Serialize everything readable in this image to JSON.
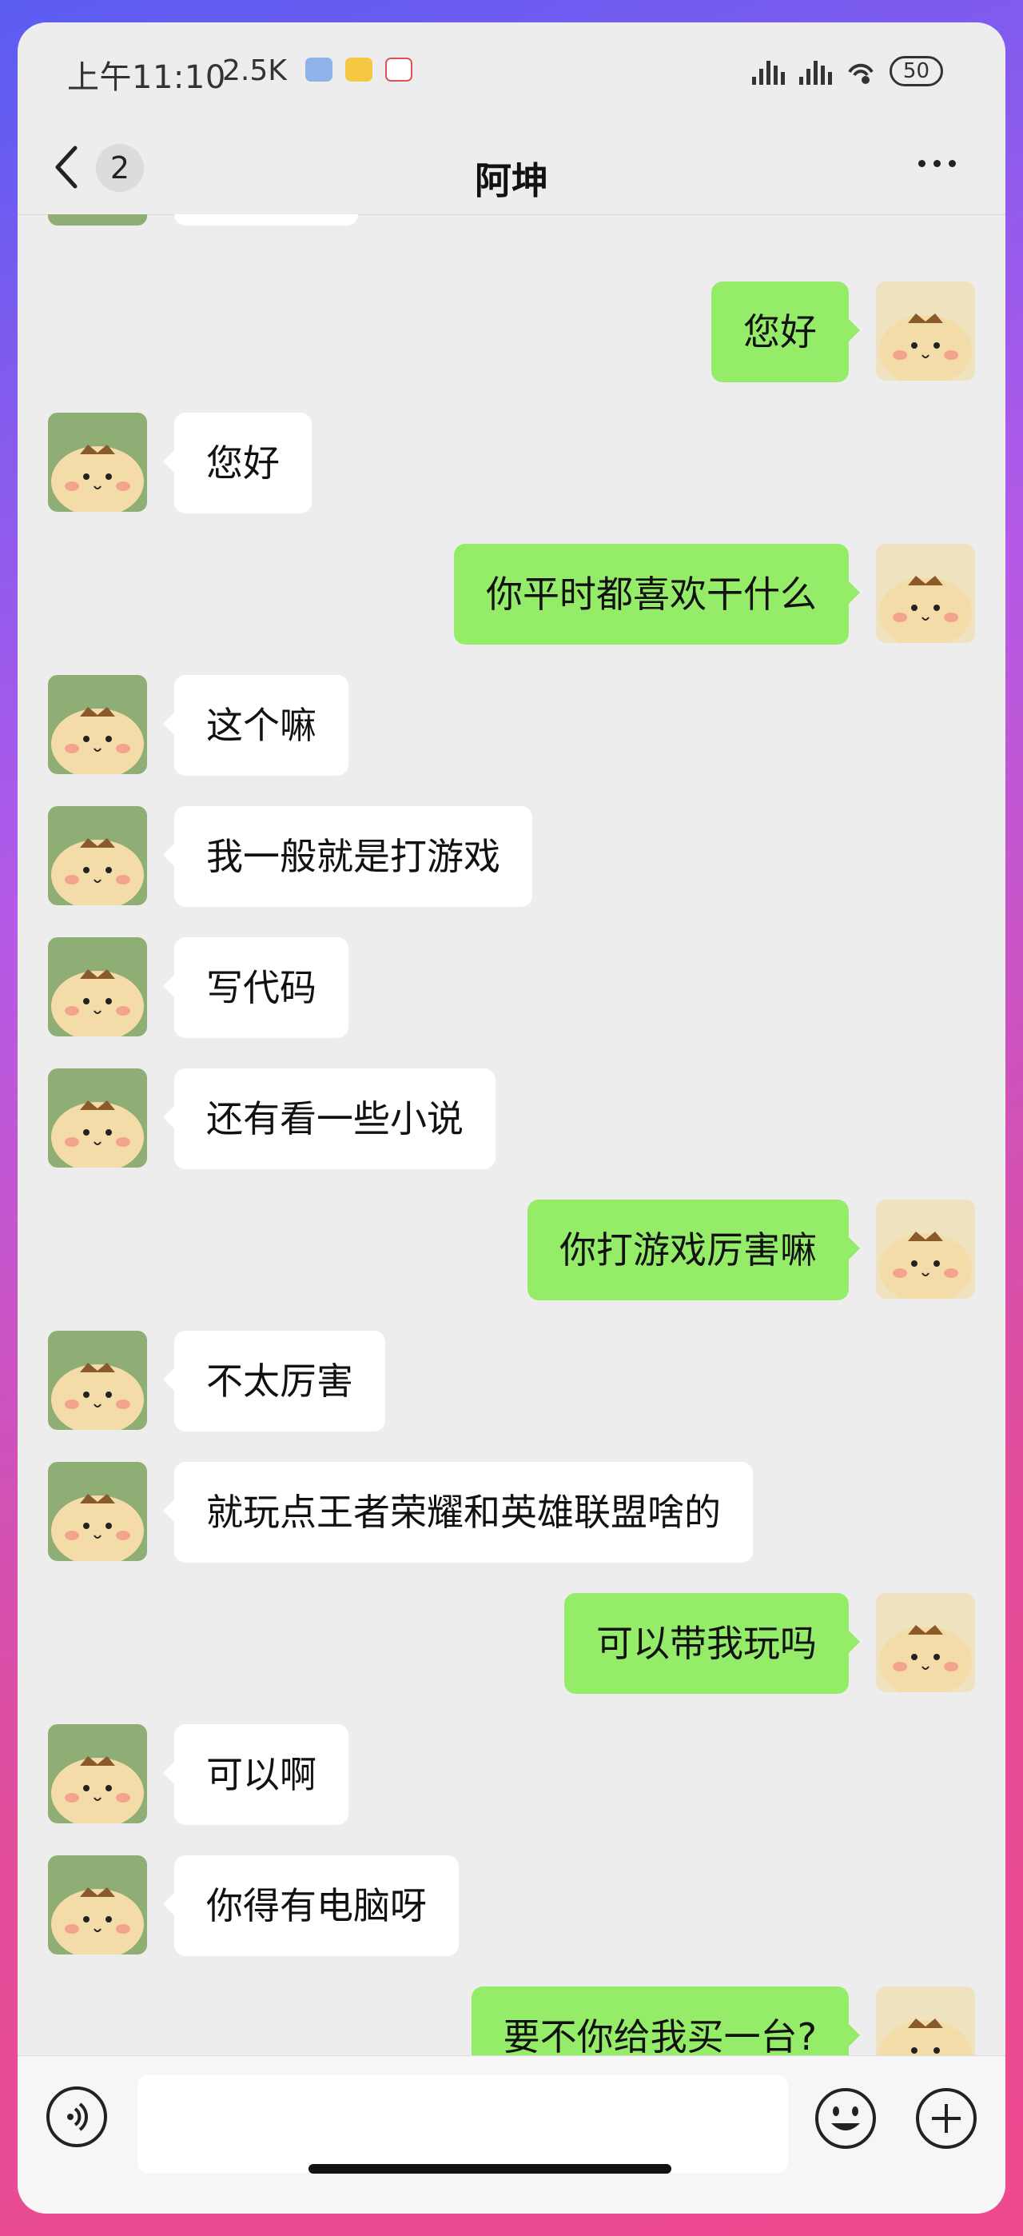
{
  "status_bar": {
    "time": "上午11:10",
    "net_speed": "2.5K",
    "battery": "50"
  },
  "header": {
    "title": "阿坤",
    "unread_count": "2"
  },
  "messages": [
    {
      "side": "out",
      "text": "您好"
    },
    {
      "side": "in",
      "text": "您好"
    },
    {
      "side": "out",
      "text": "你平时都喜欢干什么"
    },
    {
      "side": "in",
      "text": "这个嘛"
    },
    {
      "side": "in",
      "text": "我一般就是打游戏"
    },
    {
      "side": "in",
      "text": "写代码"
    },
    {
      "side": "in",
      "text": "还有看一些小说"
    },
    {
      "side": "out",
      "text": "你打游戏厉害嘛"
    },
    {
      "side": "in",
      "text": "不太厉害"
    },
    {
      "side": "in",
      "text": "就玩点王者荣耀和英雄联盟啥的"
    },
    {
      "side": "out",
      "text": "可以带我玩吗"
    },
    {
      "side": "in",
      "text": "可以啊"
    },
    {
      "side": "in",
      "text": "你得有电脑呀"
    },
    {
      "side": "out",
      "text": "要不你给我买一台?"
    }
  ],
  "input": {
    "placeholder": "",
    "value": ""
  },
  "icons": {
    "back": "chevron-left-icon",
    "more": "more-icon",
    "voice": "voice-icon",
    "emoji": "emoji-icon",
    "plus": "plus-icon"
  },
  "colors": {
    "outgoing_bubble": "#95ec69",
    "incoming_bubble": "#ffffff",
    "chat_background": "#ededed"
  }
}
